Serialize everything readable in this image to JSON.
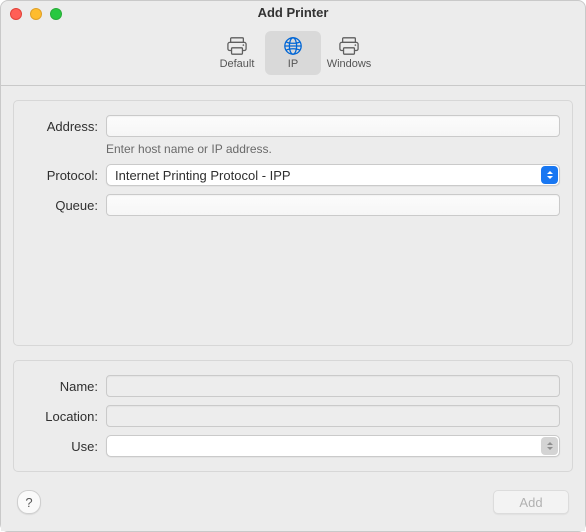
{
  "window": {
    "title": "Add Printer"
  },
  "toolbar": {
    "items": [
      {
        "id": "default",
        "label": "Default",
        "selected": false
      },
      {
        "id": "ip",
        "label": "IP",
        "selected": true
      },
      {
        "id": "windows",
        "label": "Windows",
        "selected": false
      }
    ]
  },
  "form": {
    "address": {
      "label": "Address:",
      "value": "",
      "hint": "Enter host name or IP address."
    },
    "protocol": {
      "label": "Protocol:",
      "value": "Internet Printing Protocol - IPP"
    },
    "queue": {
      "label": "Queue:",
      "value": ""
    },
    "name": {
      "label": "Name:",
      "value": ""
    },
    "location": {
      "label": "Location:",
      "value": ""
    },
    "use": {
      "label": "Use:",
      "value": ""
    }
  },
  "footer": {
    "add_label": "Add",
    "add_enabled": false,
    "help_label": "?"
  },
  "icons": {
    "default": "printer-icon",
    "ip": "globe-icon",
    "windows": "printer-icon"
  }
}
